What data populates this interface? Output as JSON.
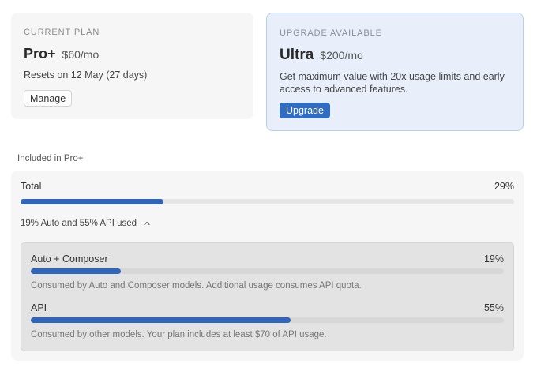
{
  "current_plan": {
    "eyebrow": "CURRENT PLAN",
    "name": "Pro+",
    "price": "$60/mo",
    "resets": "Resets on 12 May (27 days)",
    "manage_label": "Manage"
  },
  "upgrade": {
    "eyebrow": "UPGRADE AVAILABLE",
    "name": "Ultra",
    "price": "$200/mo",
    "description": "Get maximum value with 20x usage limits and early access to advanced features.",
    "button_label": "Upgrade"
  },
  "usage": {
    "included_label": "Included in Pro+",
    "total": {
      "label": "Total",
      "percent_text": "29%",
      "percent": 29
    },
    "breakdown_toggle": "19% Auto and 55% API used",
    "expanded": true,
    "items": [
      {
        "label": "Auto + Composer",
        "percent_text": "19%",
        "percent": 19,
        "description": "Consumed by Auto and Composer models. Additional usage consumes API quota."
      },
      {
        "label": "API",
        "percent_text": "55%",
        "percent": 55,
        "description": "Consumed by other models. Your plan includes at least $70 of API usage."
      }
    ]
  },
  "colors": {
    "accent": "#2f65bb",
    "upgrade_card_bg": "#e9effa",
    "upgrade_card_border": "#b9cdec",
    "card_bg": "#f6f6f6",
    "panel_bg": "#e3e3e3"
  },
  "icons": {
    "toggle": "chevron-up-icon"
  }
}
